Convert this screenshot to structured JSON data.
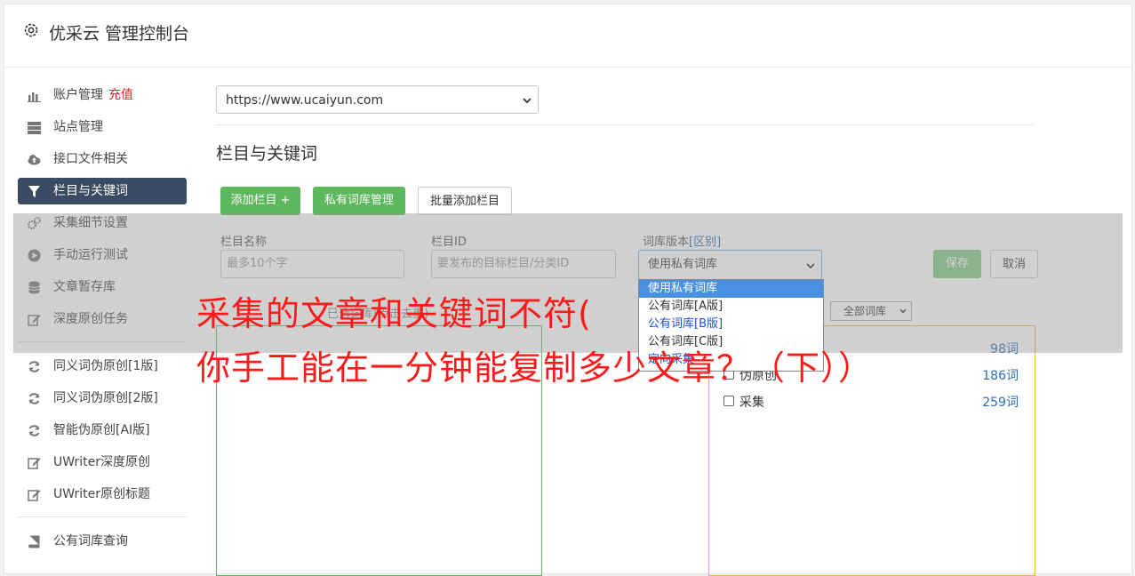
{
  "header": {
    "title": "优采云 管理控制台",
    "icon": "gear-icon"
  },
  "sidebar": {
    "items": [
      {
        "label": "账户管理",
        "extra": "充值",
        "icon": "bar-chart-icon"
      },
      {
        "label": "站点管理",
        "icon": "server-icon"
      },
      {
        "label": "接口文件相关",
        "icon": "cloud-upload-icon"
      },
      {
        "label": "栏目与关键词",
        "icon": "filter-icon",
        "active": true
      },
      {
        "label": "采集细节设置",
        "icon": "cogs-icon"
      },
      {
        "label": "手动运行测试",
        "icon": "play-icon"
      },
      {
        "label": "文章暂存库",
        "icon": "database-icon"
      },
      {
        "label": "深度原创任务",
        "icon": "edit-icon"
      },
      {
        "label": "同义词伪原创[1版]",
        "icon": "refresh-icon"
      },
      {
        "label": "同义词伪原创[2版]",
        "icon": "refresh-icon"
      },
      {
        "label": "智能伪原创[AI版]",
        "icon": "refresh-icon"
      },
      {
        "label": "UWriter深度原创",
        "icon": "edit-icon"
      },
      {
        "label": "UWriter原创标题",
        "icon": "edit-icon"
      },
      {
        "label": "公有词库查询",
        "icon": "book-icon"
      }
    ]
  },
  "main": {
    "site_select": "https://www.ucaiyun.com",
    "section_title": "栏目与关键词",
    "buttons": {
      "add_column": "添加栏目 +",
      "private_lib": "私有词库管理",
      "batch_add": "批量添加栏目"
    },
    "form": {
      "name_label": "栏目名称",
      "name_placeholder": "最多10个字",
      "id_label": "栏目ID",
      "id_placeholder": "要发布的目标栏目/分类ID",
      "version_label": "词库版本",
      "version_link": "[区别]",
      "version_value": "使用私有词库",
      "save": "保存",
      "cancel": "取消"
    },
    "dropdown_options": [
      "使用私有词库",
      "公有词库[A版]",
      "公有词库[B版]",
      "公有词库[C版]",
      "定向采集"
    ],
    "hint": "已选词库(点击去重)",
    "lib_filter": "全部词库",
    "libraries": [
      {
        "name": "",
        "count": "98词"
      },
      {
        "name": "伪原创",
        "count": "186词"
      },
      {
        "name": "采集",
        "count": "259词"
      }
    ]
  },
  "caption": {
    "line1": "采集的文章和关键词不符(",
    "line2": "你手工能在一分钟能复制多少文章？（下））"
  },
  "colors": {
    "green": "#5cb85c",
    "active_nav": "#3a4a63",
    "caption_red": "#ff1a1a",
    "link_blue": "#2a6db4"
  }
}
